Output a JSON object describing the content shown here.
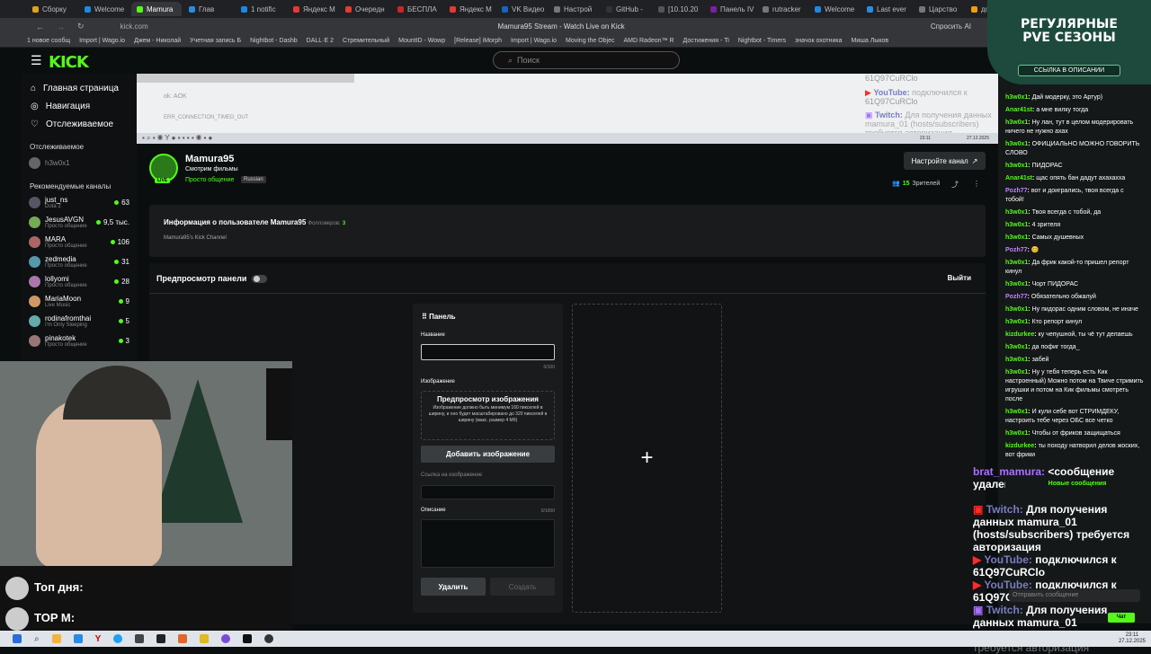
{
  "browser": {
    "tabs": [
      "Сборку",
      "Welcome",
      "Mamura",
      "Глав",
      "1 notific",
      "Яндекс М",
      "Очередн",
      "БЕСПЛА",
      "Яндекс М",
      "VK Видео",
      "Настрой",
      "GitHub -",
      "[10.10.20",
      "Панель IV",
      "rutracker",
      "Welcome",
      "Last ever",
      "Царство",
      "донат але",
      "www.don"
    ],
    "url": "kick.com",
    "title": "Mamura95 Stream - Watch Live on Kick",
    "profile_action": "Спросить AI",
    "bookmarks": [
      "1 новое сообщ",
      "Import | Wago.io",
      "Джем - Николай",
      "Учетная запись Б",
      "Nightbot - Dashb",
      "DALL·E 2",
      "Стремительный",
      "MountID - Wowp",
      "[Release] iMorph",
      "Import | Wago.io",
      "Moving the Objec",
      "AMD Radeon™ R",
      "Достижения - Ti",
      "Nightbot - Timers",
      "значок охотника",
      "Миша Лыков"
    ]
  },
  "kick": {
    "logo": "KICK",
    "search_placeholder": "Поиск",
    "nav": [
      {
        "label": "Главная страница",
        "icon": "home-icon"
      },
      {
        "label": "Навигация",
        "icon": "compass-icon"
      },
      {
        "label": "Отслеживаемое",
        "icon": "heart-icon"
      }
    ],
    "followed_header": "Отслеживаемое",
    "followed_user": "h3w0x1",
    "recommended_header": "Рекомендуемые каналы",
    "channels": [
      {
        "name": "just_ns",
        "sub": "Dota 2",
        "viewers": "63"
      },
      {
        "name": "JesusAVGN",
        "sub": "Просто общение",
        "viewers": "9,5 тыс."
      },
      {
        "name": "MARA",
        "sub": "Просто общение",
        "viewers": "106"
      },
      {
        "name": "zedmedia",
        "sub": "Просто общение",
        "viewers": "31"
      },
      {
        "name": "lollyomi",
        "sub": "Просто общение",
        "viewers": "28"
      },
      {
        "name": "MariaMoon",
        "sub": "Live Music",
        "viewers": "9"
      },
      {
        "name": "rodinafromthai",
        "sub": "I'm Only Sleeping",
        "viewers": "5"
      },
      {
        "name": "pinakotek",
        "sub": "Просто общение",
        "viewers": "3"
      }
    ]
  },
  "preview": {
    "youtube_label": "YouTube:",
    "youtube_text": "подключился к",
    "code1": "61Q97CuRClo",
    "code2": "61Q97CuRClo",
    "twitch_label": "Twitch:",
    "twitch_text": "Для получения данных",
    "twitch_text2": "mamura_01 (hosts/subscribers)",
    "twitch_text3": "требуется авторизация",
    "ok_label": "ok. AOK",
    "timeout": "ERR_CONNECTION_TIMED_OUT",
    "time": "23:11",
    "date": "27.12.2025"
  },
  "channel": {
    "name": "Mamura95",
    "title": "Смотрим фильмы",
    "category": "Просто общение",
    "language": "Russian",
    "live": "LIVE",
    "setup_button": "Настройте канал",
    "viewers_count": "15",
    "viewers_label": "Зрителей"
  },
  "about": {
    "title": "Информация о пользователе Mamura95",
    "followers_label": "Фолловеров:",
    "followers": "3",
    "desc": "Mamura95's Kick Channel"
  },
  "panel": {
    "preview_label": "Предпросмотр панели",
    "exit": "Выйти",
    "header": "Панель",
    "name_label": "Название",
    "name_counter": "0/100",
    "image_label": "Изображение",
    "image_preview_title": "Предпросмотр изображения",
    "image_hint": "Изображение должно быть минимум 160 пикселей в ширину, и оно будет масштабировано до 320 пикселей в ширину (макс. размер 4 Мб)",
    "add_image": "Добавить изображение",
    "link_label": "Ссылка на изображение",
    "desc_label": "Описание",
    "desc_counter": "0/1000",
    "delete": "Удалить",
    "create": "Создать",
    "add_symbol": "+"
  },
  "overlay": {
    "banner1": "РЕГУЛЯРНЫЕ",
    "banner2": "PVE СЕЗОНЫ",
    "banner3": "ССЫЛКА В ОПИСАНИИ",
    "top_day": "Топ дня:",
    "top_m": "TOP M:",
    "new_messages": "Новые сообщения",
    "chat_placeholder": "Отправить сообщение",
    "chat_button": "Чат",
    "big_brat": "brat_mamura:",
    "big_brat_text": "<сообщение удалено>",
    "big_twitch": "Twitch:",
    "big_twitch_text": "Для получения данных mamura_01 (hosts/subscribers) требуется авторизация",
    "big_youtube": "YouTube:",
    "big_youtube_text": "подключился к 61Q97CuRClo",
    "big_youtube2": "YouTube:",
    "big_youtube2_text": "подключился к 61Q97CuRClo",
    "big_twitch2": "Twitch:",
    "big_twitch2_text": "Для получения данных mamura_01 (hosts/subscribers)",
    "big_trailing": "требуется авторизация"
  },
  "chat": [
    {
      "user": "h3w0x1",
      "color": "#53fc18",
      "text": "Дай модерку, это Артур)"
    },
    {
      "user": "Anar41st",
      "color": "#53fc18",
      "text": "а мне вилку тогда"
    },
    {
      "user": "h3w0x1",
      "color": "#53fc18",
      "text": "Ну лан, тут в целом модерировать ничего не нужно ахах"
    },
    {
      "user": "h3w0x1",
      "color": "#53fc18",
      "text": "ОФИЦИАЛЬНО МОЖНО ГОВОРИТЬ СЛОВО"
    },
    {
      "user": "h3w0x1",
      "color": "#53fc18",
      "text": "ПИДОРАС"
    },
    {
      "user": "Anar41st",
      "color": "#53fc18",
      "text": "щас опять бан дадут ахахахха"
    },
    {
      "user": "Pozh77",
      "color": "#c084fc",
      "text": "вот и доигрались, твоя всегда с тобой!"
    },
    {
      "user": "h3w0x1",
      "color": "#53fc18",
      "text": "Твоя всегда с тобой, да"
    },
    {
      "user": "h3w0x1",
      "color": "#53fc18",
      "text": "4 зрителя"
    },
    {
      "user": "h3w0x1",
      "color": "#53fc18",
      "text": "Самых душевных"
    },
    {
      "user": "Pozh77",
      "color": "#c084fc",
      "text": "😊"
    },
    {
      "user": "h3w0x1",
      "color": "#53fc18",
      "text": "Да фрик какой-то пришел репорт кинул"
    },
    {
      "user": "h3w0x1",
      "color": "#53fc18",
      "text": "Чорт ПИДОРАС"
    },
    {
      "user": "Pozh77",
      "color": "#c084fc",
      "text": "Обязательно обжалуй"
    },
    {
      "user": "h3w0x1",
      "color": "#53fc18",
      "text": "Ну пидорас одним словом, не иначе"
    },
    {
      "user": "h3w0x1",
      "color": "#53fc18",
      "text": "Кто репорт кинул"
    },
    {
      "user": "kizdurkee",
      "color": "#53fc18",
      "text": "ку чепушной, ты чё тут делаешь"
    },
    {
      "user": "h3w0x1",
      "color": "#53fc18",
      "text": "да пофиг тогда_"
    },
    {
      "user": "h3w0x1",
      "color": "#53fc18",
      "text": "забей"
    },
    {
      "user": "h3w0x1",
      "color": "#53fc18",
      "text": "Ну у тебя теперь есть Кик настроенный) Можно потом на Твиче стримить игрушки и потом на Кик фильмы смотреть после"
    },
    {
      "user": "h3w0x1",
      "color": "#53fc18",
      "text": "И кули себе вот СТРИМДЕКУ, настроить тебе через OБС все четко"
    },
    {
      "user": "h3w0x1",
      "color": "#53fc18",
      "text": "Чтобы от фриков защищаться"
    },
    {
      "user": "kizdurkee",
      "color": "#53fc18",
      "text": "ты походу натворил делов жоских, вот фрики"
    }
  ],
  "taskbar": {
    "time": "23:11",
    "date": "27.12.2025"
  },
  "colors": {
    "accent": "#53fc18",
    "bg": "#0b0e0f",
    "youtube": "#ff2a2a",
    "twitch": "#a970ff"
  }
}
